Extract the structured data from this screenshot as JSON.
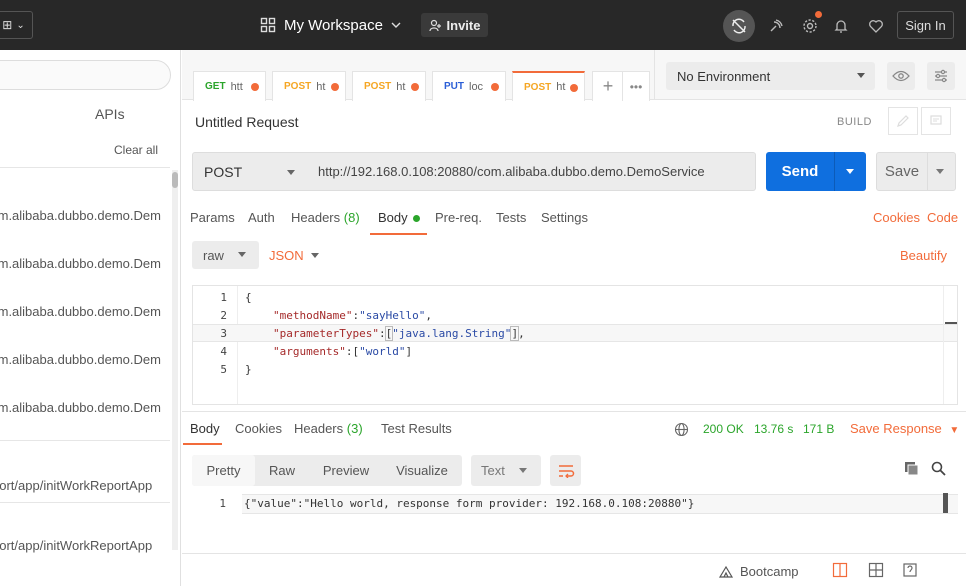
{
  "topbar": {
    "workspace_label": "My Workspace",
    "invite_label": "Invite",
    "signin_label": "Sign In"
  },
  "sidebar": {
    "apis_label": "APIs",
    "clear_all_label": "Clear all",
    "history": [
      ".m.alibaba.dubbo.demo.Dem",
      ".m.alibaba.dubbo.demo.Dem",
      ".m.alibaba.dubbo.demo.Dem",
      ".m.alibaba.dubbo.demo.Dem",
      ".m.alibaba.dubbo.demo.Dem",
      "port/app/initWorkReportApp",
      "port/app/initWorkReportApp"
    ]
  },
  "tabs": [
    {
      "method": "GET",
      "label": "htt",
      "color": "#2ba52b"
    },
    {
      "method": "POST",
      "label": "ht",
      "color": "#f5a623"
    },
    {
      "method": "POST",
      "label": "ht",
      "color": "#f5a623"
    },
    {
      "method": "PUT",
      "label": "loc",
      "color": "#2a5ed6"
    },
    {
      "method": "POST",
      "label": "ht",
      "color": "#f5a623"
    }
  ],
  "environment": {
    "selected": "No Environment"
  },
  "request": {
    "title": "Untitled Request",
    "build_label": "BUILD",
    "method": "POST",
    "url": "http://192.168.0.108:20880/com.alibaba.dubbo.demo.DemoService",
    "send_label": "Send",
    "save_label": "Save",
    "subtabs": {
      "params": "Params",
      "auth": "Auth",
      "headers": "Headers",
      "headers_count": "(8)",
      "body": "Body",
      "prereq": "Pre-req.",
      "tests": "Tests",
      "settings": "Settings",
      "cookies": "Cookies",
      "code": "Code"
    },
    "body_mode": "raw",
    "body_format": "JSON",
    "beautify_label": "Beautify",
    "body_lines": [
      {
        "n": "1"
      },
      {
        "n": "2"
      },
      {
        "n": "3"
      },
      {
        "n": "4"
      },
      {
        "n": "5"
      }
    ],
    "code": {
      "l1": "{",
      "l2_key": "\"methodName\"",
      "l2_val": "\"sayHello\"",
      "l3_key": "\"parameterTypes\"",
      "l3_val": "\"java.lang.String\"",
      "l4_key": "\"arguments\"",
      "l4_val": "\"world\"",
      "l5": "}"
    }
  },
  "response": {
    "tabs": {
      "body": "Body",
      "cookies": "Cookies",
      "headers": "Headers",
      "headers_count": "(3)",
      "test_results": "Test Results"
    },
    "status": "200 OK",
    "time": "13.76 s",
    "size": "171 B",
    "save_response_label": "Save Response",
    "views": {
      "pretty": "Pretty",
      "raw": "Raw",
      "preview": "Preview",
      "visualize": "Visualize"
    },
    "format": "Text",
    "line_number": "1",
    "body_text": "{\"value\":\"Hello world, response form provider: 192.168.0.108:20880\"}"
  },
  "footer": {
    "bootcamp_label": "Bootcamp"
  }
}
